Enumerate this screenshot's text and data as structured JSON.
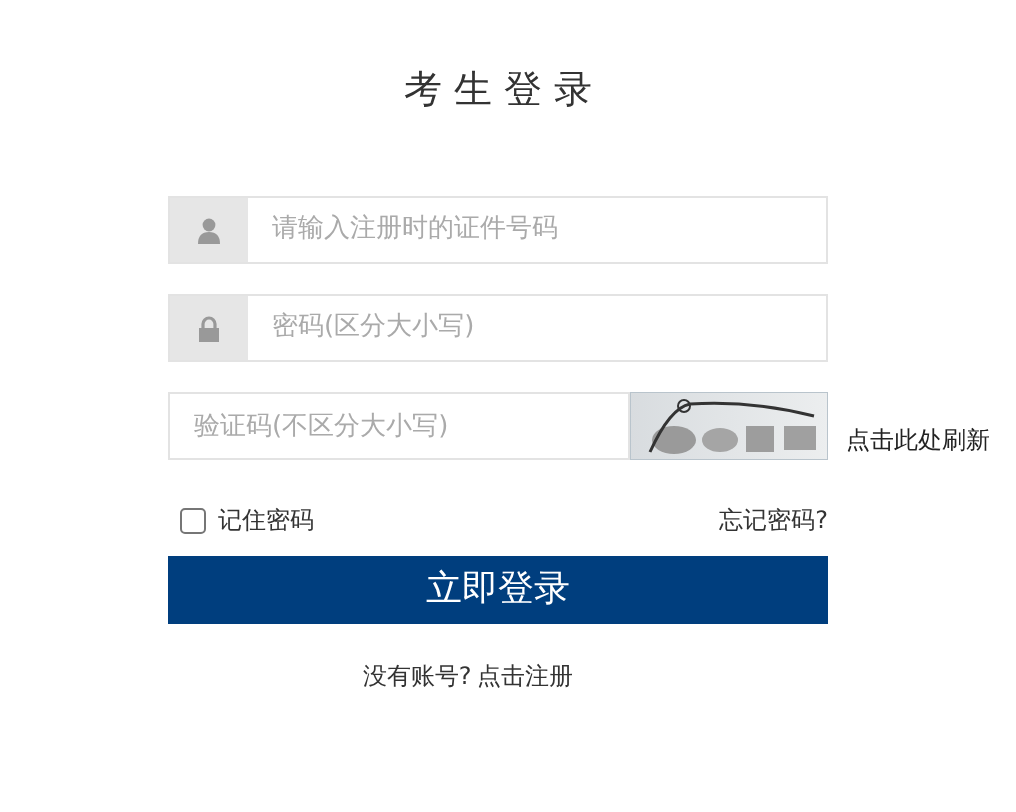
{
  "title": "考 生 登 录",
  "fields": [
    {
      "kind": "user",
      "placeholder": "请输入注册时的证件号码"
    },
    {
      "kind": "lock",
      "placeholder": "密码(区分大小写)"
    }
  ],
  "captcha": {
    "placeholder": "验证码(不区分大小写)",
    "refresh": "点击此处刷新"
  },
  "remember": {
    "label": "记住密码",
    "checked": false
  },
  "forgot": "忘记密码?",
  "submit": "立即登录",
  "footer": {
    "text": "没有账号?",
    "link": "点击注册"
  }
}
